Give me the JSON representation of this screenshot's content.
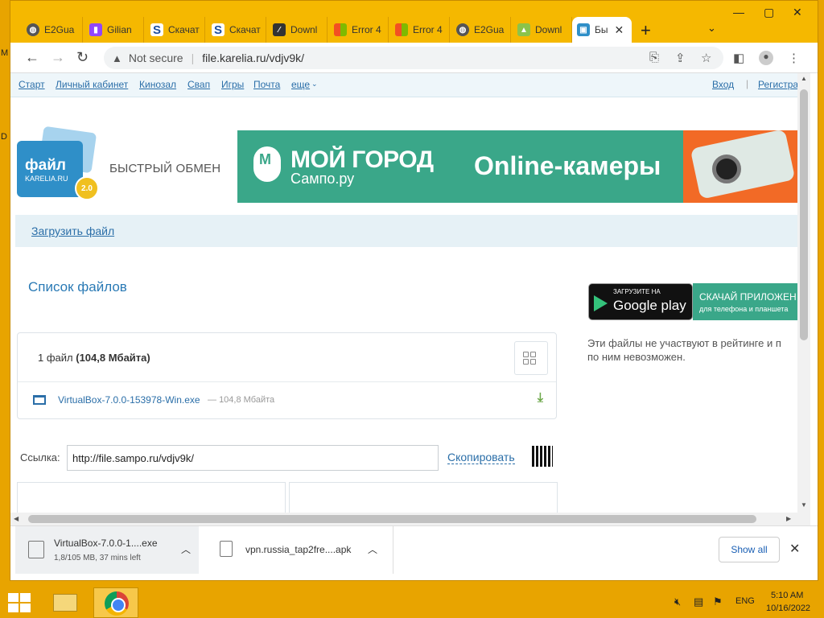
{
  "desktop": {
    "letters": [
      "M",
      "D"
    ]
  },
  "tabs": [
    {
      "label": "E2Gua",
      "icon": "globe-icon",
      "color": "#555555",
      "active": false
    },
    {
      "label": "Gilian",
      "icon": "twitch-icon",
      "color": "#9146ff",
      "active": false
    },
    {
      "label": "Скачат",
      "icon": "s-logo-icon",
      "color": "#1c4e9e",
      "active": false
    },
    {
      "label": "Скачат",
      "icon": "s-logo-icon",
      "color": "#1c4e9e",
      "active": false
    },
    {
      "label": "Downl",
      "icon": "document-icon",
      "color": "#333333",
      "active": false
    },
    {
      "label": "Error 4",
      "icon": "windows-logo-icon",
      "color": "#f25022",
      "active": false
    },
    {
      "label": "Error 4",
      "icon": "windows-logo-icon",
      "color": "#f25022",
      "active": false
    },
    {
      "label": "E2Gua",
      "icon": "globe-icon",
      "color": "#555555",
      "active": false
    },
    {
      "label": "Downl",
      "icon": "android-icon",
      "color": "#8bc34a",
      "active": false
    },
    {
      "label": "Бы",
      "icon": "file-karelia-icon",
      "color": "#2f8fc8",
      "active": true
    }
  ],
  "toolbar": {
    "security_label": "Not secure",
    "url": "file.karelia.ru/vdjv9k/"
  },
  "topnav": {
    "links": [
      "Старт",
      "Личный кабинет",
      "Кинозал",
      "Свап",
      "Игры",
      "Почта",
      "еще"
    ],
    "login": "Вход",
    "register": "Регистра"
  },
  "logo": {
    "text": "файл",
    "sub": "KARELIA.RU",
    "badge": "2.0"
  },
  "tagline": "БЫСТРЫЙ ОБМЕН",
  "banner": {
    "title": "МОЙ ГОРОД",
    "subtitle": "Сампо.ру",
    "cameras": "Online-камеры",
    "pin_letter": "М"
  },
  "upload_link": "Загрузить файл",
  "files_heading": "Список файлов",
  "file_summary": {
    "count": "1 файл",
    "size": "(104,8 Мбайта)"
  },
  "files": [
    {
      "name": "VirtualBox-7.0.0-153978-Win.exe",
      "dash": "—",
      "size": "104,8 Мбайта"
    }
  ],
  "share": {
    "label": "Ссылка:",
    "url": "http://file.sampo.ru/vdjv9k/",
    "copy": "Скопировать"
  },
  "google_play": {
    "small": "ЗАГРУЗИТЕ НА",
    "big": "Google play",
    "promo_line1": "СКАЧАЙ ПРИЛОЖЕН",
    "promo_line2": "для телефона и планшета"
  },
  "side_note": [
    "Эти файлы не участвуют в рейтинге и п",
    "по ним невозможен."
  ],
  "downloads": [
    {
      "name": "VirtualBox-7.0.0-1....exe",
      "status": "1,8/105 MB, 37 mins left"
    },
    {
      "name": "vpn.russia_tap2fre....apk",
      "status": ""
    }
  ],
  "downloads_show_all": "Show all",
  "taskbar": {
    "lang": "ENG",
    "time": "5:10 AM",
    "date": "10/16/2022"
  }
}
